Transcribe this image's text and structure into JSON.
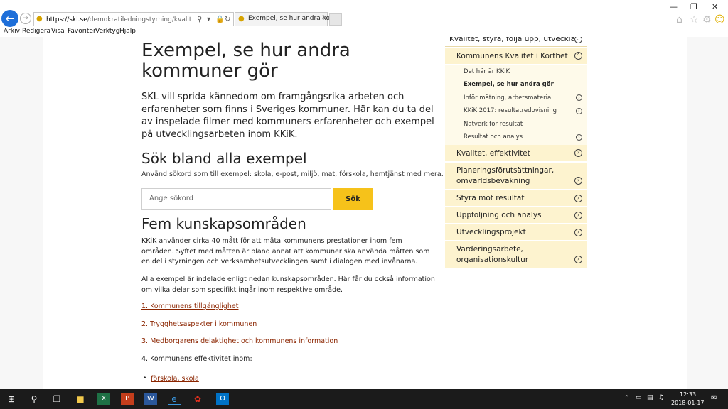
{
  "browser": {
    "url_host": "https://skl.se",
    "url_path": "/demokratiledningstyrning/kvalitetstyrafoljaup",
    "tab_title": "Exempel, se hur andra kom...",
    "menu": [
      "Arkiv",
      "Redigera",
      "Visa",
      "Favoriter",
      "Verktyg",
      "Hjälp"
    ]
  },
  "main": {
    "title": "Exempel, se hur andra kommuner gör",
    "intro": "SKL vill sprida kännedom om framgångsrika arbeten och erfarenheter som finns i Sveriges kommuner. Här kan du ta del av inspelade filmer med kommuners erfarenheter och exempel på utvecklingsarbeten inom KKiK.",
    "search_heading": "Sök bland alla exempel",
    "search_hint": "Använd sökord som till exempel: skola, e-post, miljö, mat, förskola, hemtjänst med mera.",
    "search_placeholder": "Ange sökord",
    "search_button": "Sök",
    "areas_heading": "Fem kunskapsområden",
    "p1": "KKiK använder cirka 40 mått för att mäta kommunens prestationer inom fem områden. Syftet med måtten är bland annat att kommuner ska använda måtten som en del i styrningen och verksamhetsutvecklingen samt i dialogen med invånarna.",
    "p2": "Alla exempel är indelade enligt nedan kunskapsområden. Här får du också information om vilka delar som specifikt ingår inom respektive område.",
    "links": [
      "1. Kommunens tillgänglighet",
      "2. Trygghetsaspekter i kommunen",
      "3. Medborgarens delaktighet och kommunens information"
    ],
    "area4": "4. Kommunens effektivitet inom:",
    "sub_link": "förskola, skola"
  },
  "sidebar": {
    "top": "Kvalitet, styra, följa upp, utveckla",
    "section": "Kommunens Kvalitet i Korthet",
    "subitems": [
      "Det här är KKiK",
      "Exempel, se hur andra gör",
      "Inför mätning, arbetsmaterial",
      "KKiK 2017: resultatredovisning",
      "Nätverk för resultat",
      "Resultat och analys"
    ],
    "items": [
      "Kvalitet, effektivitet",
      "Planeringsförutsättningar, omvärldsbevakning",
      "Styra mot resultat",
      "Uppföljning och analys",
      "Utvecklingsprojekt",
      "Värderingsarbete, organisationskultur"
    ]
  },
  "taskbar": {
    "time": "12:33",
    "date": "2018-01-17"
  },
  "colors": {
    "accent_yellow": "#f6c21a",
    "link_red": "#8b2500",
    "sidebar_bg": "#fdf3cf",
    "taskbar": "#1b1b1b"
  }
}
